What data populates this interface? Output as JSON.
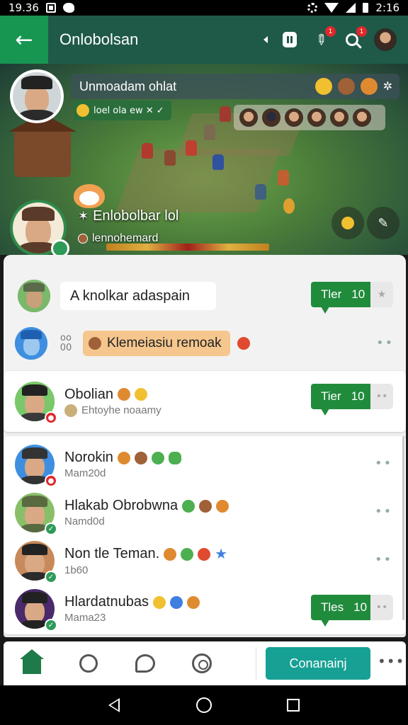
{
  "status_bar": {
    "time_left": "19.36",
    "time_right": "2:16"
  },
  "app_bar": {
    "title": "Onlobolsan",
    "back_icon": "arrow-left-icon",
    "notif_badge_a": "1",
    "notif_badge_b": "1"
  },
  "banner": {
    "chat_pill_text": "Unmoadam ohlat",
    "tag_pill_text": "loel ola ew ✕ ✓",
    "player_name": "Enlobolbar lol",
    "player_sub": "lennohemard"
  },
  "list": {
    "message_row": {
      "text": "A knolkar adaspain",
      "tier_label": "Tler",
      "tier_value": "10"
    },
    "orange_row": {
      "stamp_top": "oo",
      "stamp_bottom": "00",
      "text": "Klemeiasiu remoak"
    },
    "card_row": {
      "name": "Obolian",
      "sub": "Ehtoyhe noaamy",
      "tier_label": "Tier",
      "tier_value": "10"
    },
    "contacts": [
      {
        "name": "Norokin",
        "sub": "Mam20d",
        "badge": "red"
      },
      {
        "name": "Hlakab Obrobwna",
        "sub": "Namd0d",
        "badge": "green"
      },
      {
        "name": "Non tle Teman.",
        "sub": "1b60",
        "badge": "green"
      },
      {
        "name": "Hlardatnubas",
        "sub": "Mama23",
        "badge": "green",
        "tier_label": "Tles",
        "tier_value": "10"
      }
    ]
  },
  "bottom_nav": {
    "connect_label": "Conanainj",
    "more": "•••"
  },
  "colors": {
    "appbar": "#1f5a49",
    "accent_green": "#218b3c",
    "teal_button": "#17a094"
  }
}
